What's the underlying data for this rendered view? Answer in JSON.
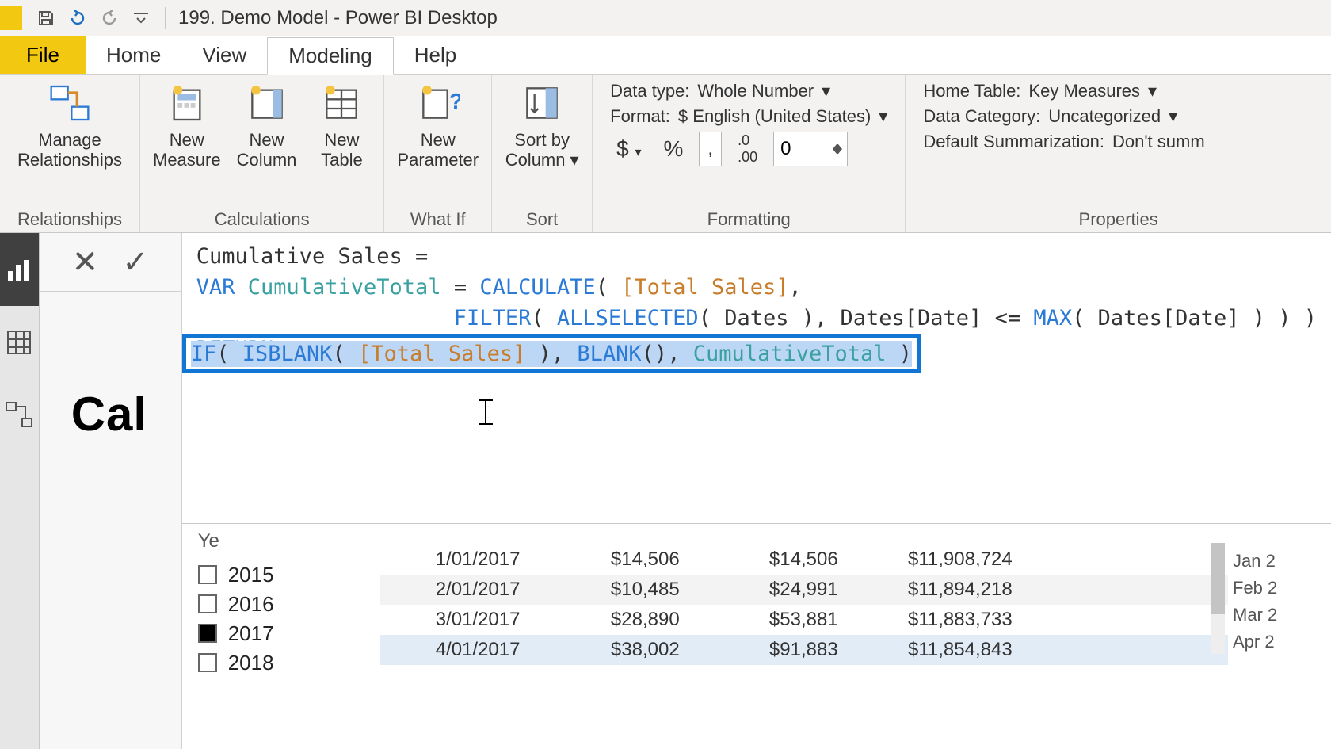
{
  "window": {
    "title": "199. Demo Model - Power BI Desktop"
  },
  "tabs": {
    "file": "File",
    "home": "Home",
    "view": "View",
    "modeling": "Modeling",
    "help": "Help"
  },
  "ribbon": {
    "relationships": {
      "manage": "Manage\nRelationships",
      "group": "Relationships"
    },
    "calculations": {
      "measure": "New\nMeasure",
      "column": "New\nColumn",
      "table": "New\nTable",
      "group": "Calculations"
    },
    "whatif": {
      "param": "New\nParameter",
      "group": "What If"
    },
    "sort": {
      "btn": "Sort by\nColumn",
      "group": "Sort"
    },
    "formatting": {
      "datatype_label": "Data type:",
      "datatype_value": "Whole Number",
      "format_label": "Format:",
      "format_value": "$ English (United States)",
      "currency": "$",
      "percent": "%",
      "thousands": ",",
      "decimals_icon": ".00",
      "decimals_value": "0",
      "group": "Formatting"
    },
    "properties": {
      "hometable_label": "Home Table:",
      "hometable_value": "Key Measures",
      "category_label": "Data Category:",
      "category_value": "Uncategorized",
      "summ_label": "Default Summarization:",
      "summ_value": "Don't summ",
      "group": "Properties"
    }
  },
  "formula": {
    "line1_a": "Cumulative Sales =",
    "var_kw": "VAR ",
    "var_name": "CumulativeTotal",
    "eq": " = ",
    "calc": "CALCULATE",
    "open": "( ",
    "totalsales": "[Total Sales]",
    "comma": ",",
    "filter": "FILTER",
    "allsel": "ALLSELECTED",
    "dates_tbl": "Dates",
    "dates_col": "Dates[Date]",
    "lte": " <= ",
    "max": "MAX",
    "return_kw": "RETURN",
    "if_line": {
      "if": "IF",
      "isblank": "ISBLANK",
      "blank": "BLANK",
      "cumvar": "CumulativeTotal"
    },
    "indent": "                    ",
    "close3": " ) ) )",
    "close1": " )",
    "op": "( ",
    "cp": " )",
    "noarg": "()"
  },
  "visual": {
    "title_fragment": "Cal"
  },
  "slicer": {
    "header": "Ye",
    "years": [
      {
        "label": "2015",
        "checked": false
      },
      {
        "label": "2016",
        "checked": false
      },
      {
        "label": "2017",
        "checked": true
      },
      {
        "label": "2018",
        "checked": false
      }
    ]
  },
  "table": {
    "rows": [
      {
        "date": "1/01/2017",
        "v1": "$14,506",
        "v2": "$14,506",
        "v3": "$11,908,724"
      },
      {
        "date": "2/01/2017",
        "v1": "$10,485",
        "v2": "$24,991",
        "v3": "$11,894,218"
      },
      {
        "date": "3/01/2017",
        "v1": "$28,890",
        "v2": "$53,881",
        "v3": "$11,883,733"
      },
      {
        "date": "4/01/2017",
        "v1": "$38,002",
        "v2": "$91,883",
        "v3": "$11,854,843"
      }
    ]
  },
  "far_right": {
    "items": [
      "Jan 2",
      "Feb 2",
      "Mar 2",
      "Apr 2"
    ]
  }
}
